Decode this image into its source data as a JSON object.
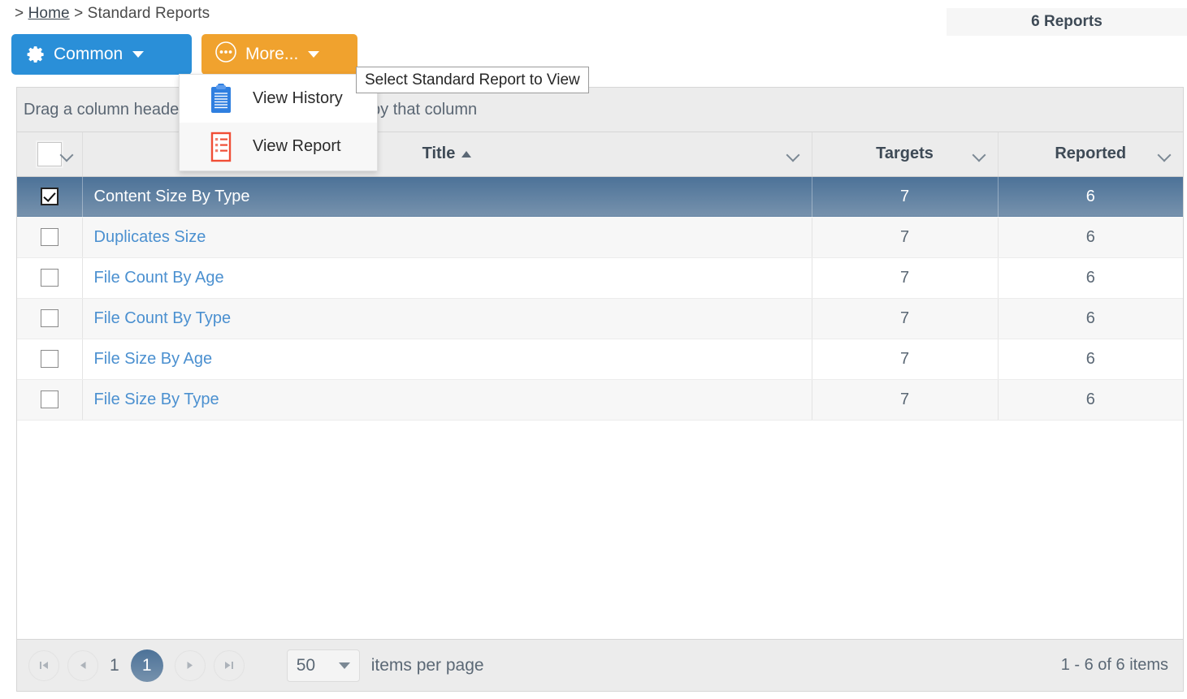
{
  "breadcrumb": {
    "lead": ">",
    "home": "Home",
    "sep": ">",
    "current": "Standard Reports"
  },
  "header": {
    "reports_count": "6 Reports"
  },
  "toolbar": {
    "common_label": "Common",
    "more_label": "More...",
    "common_color": "#2a8fd8",
    "more_color": "#f0a22e"
  },
  "dropdown": {
    "items": [
      {
        "label": "View History",
        "icon": "clipboard-icon"
      },
      {
        "label": "View Report",
        "icon": "report-list-icon"
      }
    ]
  },
  "tooltip": {
    "text": "Select Standard Report to View"
  },
  "grid": {
    "group_hint": "Drag a column header and drop it here to group by that column",
    "columns": [
      {
        "key": "check",
        "label": ""
      },
      {
        "key": "title",
        "label": "Title",
        "sorted": "asc"
      },
      {
        "key": "targets",
        "label": "Targets"
      },
      {
        "key": "reported",
        "label": "Reported"
      }
    ],
    "rows": [
      {
        "title": "Content Size By Type",
        "targets": "7",
        "reported": "6",
        "selected": true,
        "checked": true
      },
      {
        "title": "Duplicates Size",
        "targets": "7",
        "reported": "6",
        "selected": false,
        "checked": false
      },
      {
        "title": "File Count By Age",
        "targets": "7",
        "reported": "6",
        "selected": false,
        "checked": false
      },
      {
        "title": "File Count By Type",
        "targets": "7",
        "reported": "6",
        "selected": false,
        "checked": false
      },
      {
        "title": "File Size By Age",
        "targets": "7",
        "reported": "6",
        "selected": false,
        "checked": false
      },
      {
        "title": "File Size By Type",
        "targets": "7",
        "reported": "6",
        "selected": false,
        "checked": false
      }
    ]
  },
  "pager": {
    "page_number_plain": "1",
    "current_page": "1",
    "page_size": "50",
    "items_per_page_label": "items per page",
    "range_label": "1 - 6 of 6 items",
    "accent_color": "#5a7da1"
  }
}
